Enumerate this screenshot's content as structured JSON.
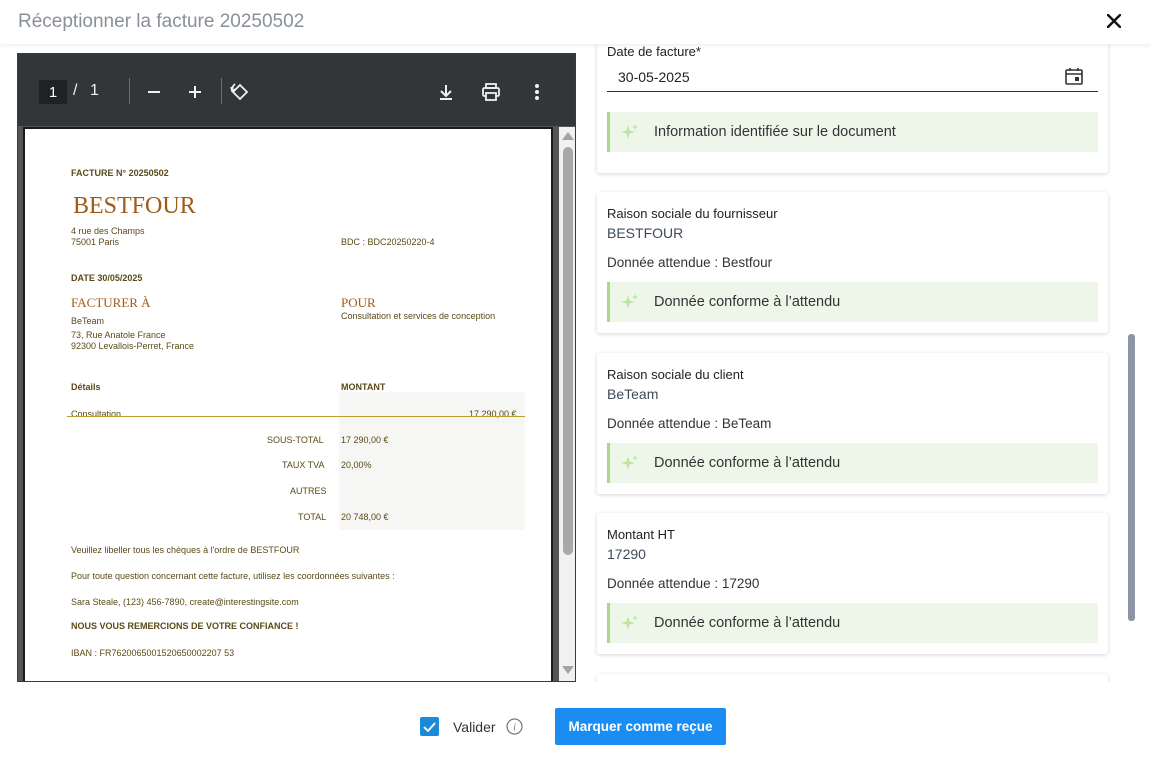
{
  "header": {
    "title": "Réceptionner la facture 20250502",
    "close_icon": "close-icon"
  },
  "viewer": {
    "page_current": "1",
    "page_separator": "/",
    "page_total": "1",
    "icons": [
      "zoom-out-icon",
      "zoom-in-icon",
      "rotate-icon",
      "download-icon",
      "print-icon",
      "more-vert-icon"
    ]
  },
  "invoice": {
    "number": "FACTURE N° 20250502",
    "brand": "BESTFOUR",
    "address1": "4 rue des Champs",
    "address2": "75001 Paris",
    "bdc": "BDC : BDC20250220-4",
    "date": "DATE 30/05/2025",
    "bill_to_title": "FACTURER À",
    "bill_to_name": "BeTeam",
    "bill_to_addr1": "73, Rue Anatole France",
    "bill_to_addr2": "92300 Levallois-Perret, France",
    "for_title": "POUR",
    "for_desc": "Consultation et services de conception",
    "col_details": "Détails",
    "col_amount": "MONTANT",
    "line_item": "Consultation",
    "line_amount": "17 290,00 €",
    "subtotal_label": "SOUS-TOTAL",
    "subtotal_value": "17 290,00 €",
    "vat_label": "TAUX TVA",
    "vat_value": "20,00%",
    "other_label": "AUTRES",
    "total_label": "TOTAL",
    "total_value": "20 748,00 €",
    "note1": "Veuillez libeller tous les chèques à l'ordre de BESTFOUR",
    "note2": "Pour toute question concernant cette facture, utilisez les coordonnées suivantes :",
    "contact": "Sara Steale, (123) 456-7890, create@interestingsite.com",
    "thanks": "NOUS VOUS REMERCIONS DE VOTRE CONFIANCE !",
    "iban": "IBAN : FR7620065001520650002207 53"
  },
  "panel": {
    "date_card": {
      "label": "Date de facture*",
      "value": "30-05-2025",
      "info": "Information identifiée sur le document"
    },
    "supplier_card": {
      "label": "Raison sociale du fournisseur",
      "value": "BESTFOUR",
      "expected": "Donnée attendue : Bestfour",
      "status": "Donnée conforme à l’attendu"
    },
    "client_card": {
      "label": "Raison sociale du client",
      "value": "BeTeam",
      "expected": "Donnée attendue : BeTeam",
      "status": "Donnée conforme à l’attendu"
    },
    "amount_card": {
      "label": "Montant HT",
      "value": "17290",
      "expected": "Donnée attendue : 17290",
      "status": "Donnée conforme à l’attendu"
    }
  },
  "footer": {
    "checkbox_checked": true,
    "validate_label": "Valider",
    "primary_button": "Marquer comme reçue"
  },
  "colors": {
    "accent": "#1b8df2",
    "success_bg": "#eef6ea",
    "success_border": "#a6d98f",
    "brand": "#a05a1a"
  }
}
